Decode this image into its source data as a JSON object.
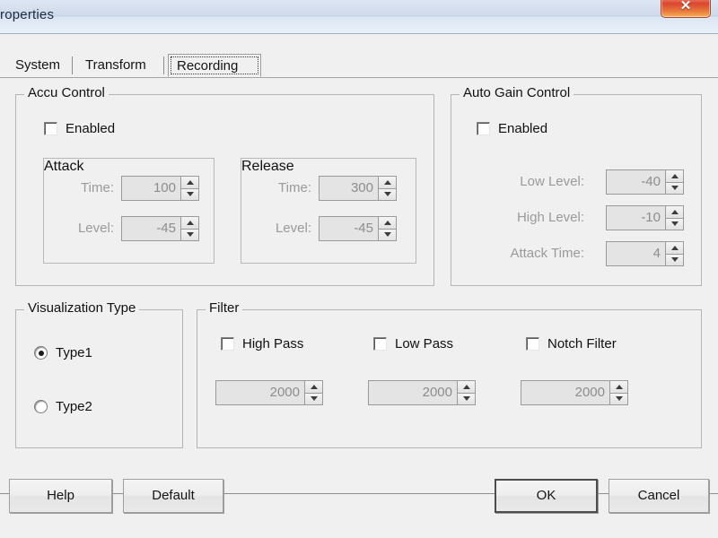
{
  "window": {
    "title": "roperties",
    "close_icon": "close-icon",
    "close_glyph": "✕"
  },
  "tabs": [
    {
      "label": "System",
      "selected": false
    },
    {
      "label": "Transform",
      "selected": false
    },
    {
      "label": "Recording",
      "selected": true
    }
  ],
  "accu_control": {
    "title": "Accu Control",
    "enabled_label": "Enabled",
    "enabled_checked": false,
    "attack": {
      "title": "Attack",
      "time_label": "Time:",
      "time_value": "100",
      "level_label": "Level:",
      "level_value": "-45"
    },
    "release": {
      "title": "Release",
      "time_label": "Time:",
      "time_value": "300",
      "level_label": "Level:",
      "level_value": "-45"
    }
  },
  "auto_gain_control": {
    "title": "Auto Gain Control",
    "enabled_label": "Enabled",
    "enabled_checked": false,
    "low_level_label": "Low Level:",
    "low_level_value": "-40",
    "high_level_label": "High Level:",
    "high_level_value": "-10",
    "attack_time_label": "Attack Time:",
    "attack_time_value": "4"
  },
  "visualization_type": {
    "title": "Visualization Type",
    "options": [
      {
        "label": "Type1",
        "selected": true
      },
      {
        "label": "Type2",
        "selected": false
      }
    ]
  },
  "filter": {
    "title": "Filter",
    "items": [
      {
        "label": "High Pass",
        "checked": false,
        "value": "2000"
      },
      {
        "label": "Low Pass",
        "checked": false,
        "value": "2000"
      },
      {
        "label": "Notch Filter",
        "checked": false,
        "value": "2000"
      }
    ]
  },
  "buttons": {
    "help": "Help",
    "default": "Default",
    "ok": "OK",
    "cancel": "Cancel"
  },
  "colors": {
    "dialog_bg": "#f0f0f0",
    "title_bar": "#d2dced",
    "close_red": "#d9452f",
    "disabled_text": "#9a9a9a",
    "group_border": "#b4b4b4"
  }
}
